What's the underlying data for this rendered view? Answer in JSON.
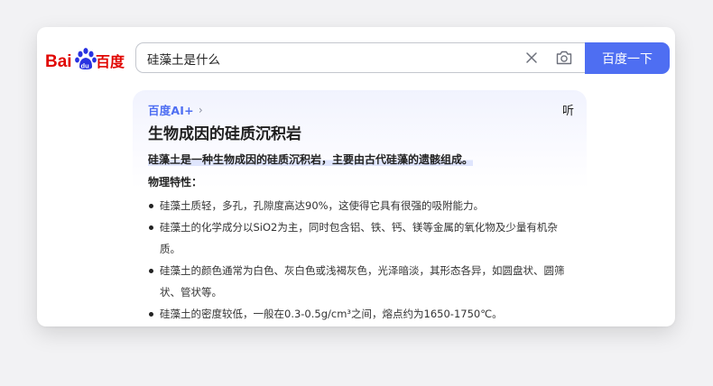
{
  "header": {
    "logo_text": "Bai百度",
    "search": {
      "value": "硅藻土是什么",
      "placeholder": ""
    },
    "clear_icon": "close-icon",
    "camera_icon": "camera-icon",
    "search_button_label": "百度一下",
    "accent_color": "#4e6ef2"
  },
  "ai_answer": {
    "brand": "百度AI+",
    "listen_label": "听",
    "title": "生物成因的硅质沉积岩",
    "summary": "硅藻土是一种生物成因的硅质沉积岩，主要由古代硅藻的遗骸组成。",
    "section_heading": "物理特性：",
    "bullets": [
      "硅藻土质轻，多孔，孔隙度高达90%，这使得它具有很强的吸附能力。",
      "硅藻土的化学成分以SiO2为主，同时包含铝、铁、钙、镁等金属的氧化物及少量有机杂质。",
      "硅藻土的颜色通常为白色、灰白色或浅褐灰色，光泽暗淡，其形态各异，如圆盘状、圆筛状、管状等。",
      "硅藻土的密度较低，一般在0.3-0.5g/cm³之间，熔点约为1650-1750℃。"
    ]
  }
}
